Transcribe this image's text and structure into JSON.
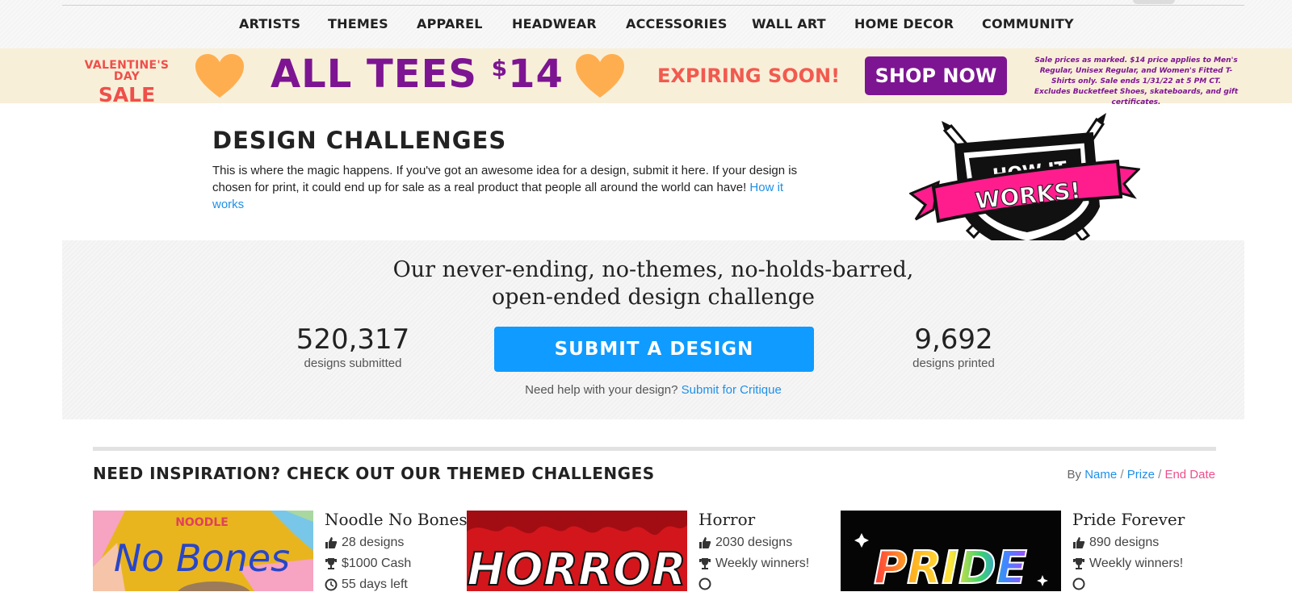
{
  "nav": {
    "items": [
      "ARTISTS",
      "THEMES",
      "APPAREL",
      "HEADWEAR",
      "ACCESSORIES",
      "WALL ART",
      "HOME DECOR",
      "COMMUNITY"
    ]
  },
  "promo": {
    "vday_line1": "VALENTINE'S DAY",
    "vday_line2": "SALE",
    "all_tees": "ALL TEES ",
    "price_symbol": "$",
    "price": "14",
    "expiring": "EXPIRING SOON!",
    "shop_now": "SHOP NOW",
    "fine_print": "Sale prices as marked. $14 price applies to Men's Regular, Unisex Regular, and Women's Fitted T-Shirts only. Sale ends 1/31/22 at 5 PM CT. Excludes Bucketfeet Shoes, skateboards, and gift certificates.",
    "colors": {
      "background": "#f8efd9",
      "purple": "#7d1592",
      "coral": "#f25a4f",
      "heart": "#ffae4f"
    }
  },
  "intro": {
    "title": "DESIGN CHALLENGES",
    "description": "This is where the magic happens. If you've got an awesome idea for a design, submit it here. If your design is chosen for print, it could end up for sale as a real product that people all around the world can have! ",
    "link": "How it works",
    "badge_line1": "HOW IT",
    "badge_line2": "WORKS!"
  },
  "hero": {
    "headline_line1": "Our never-ending, no-themes, no-holds-barred,",
    "headline_line2": "open-ended design challenge",
    "submitted_count": "520,317",
    "submitted_label": "designs submitted",
    "submit_button": "SUBMIT A DESIGN",
    "printed_count": "9,692",
    "printed_label": "designs printed",
    "help_text": "Need help with your design? ",
    "help_link": "Submit for Critique",
    "accent": "#0f9bff"
  },
  "themed": {
    "title": "NEED INSPIRATION? CHECK OUT OUR THEMED CHALLENGES",
    "sort_prefix": "By ",
    "sort_options": [
      "Name",
      "Prize",
      "End Date"
    ],
    "sort_separator": "/",
    "active_sort": "End Date",
    "cards": [
      {
        "name": "Noodle No Bones",
        "designs": "28 designs",
        "prize": "$1000 Cash",
        "extra": "55 days left",
        "thumb_small": "NOODLE",
        "thumb_big": "No Bones"
      },
      {
        "name": "Horror",
        "designs": "2030 designs",
        "prize": "Weekly winners!",
        "thumb_big": "HORROR"
      },
      {
        "name": "Pride Forever",
        "designs": "890 designs",
        "prize": "Weekly winners!",
        "thumb_big": "PRIDE"
      }
    ]
  },
  "icons": [
    "thumbs-up-icon",
    "trophy-icon",
    "clock-icon",
    "heart-icon",
    "pencil-icon"
  ]
}
